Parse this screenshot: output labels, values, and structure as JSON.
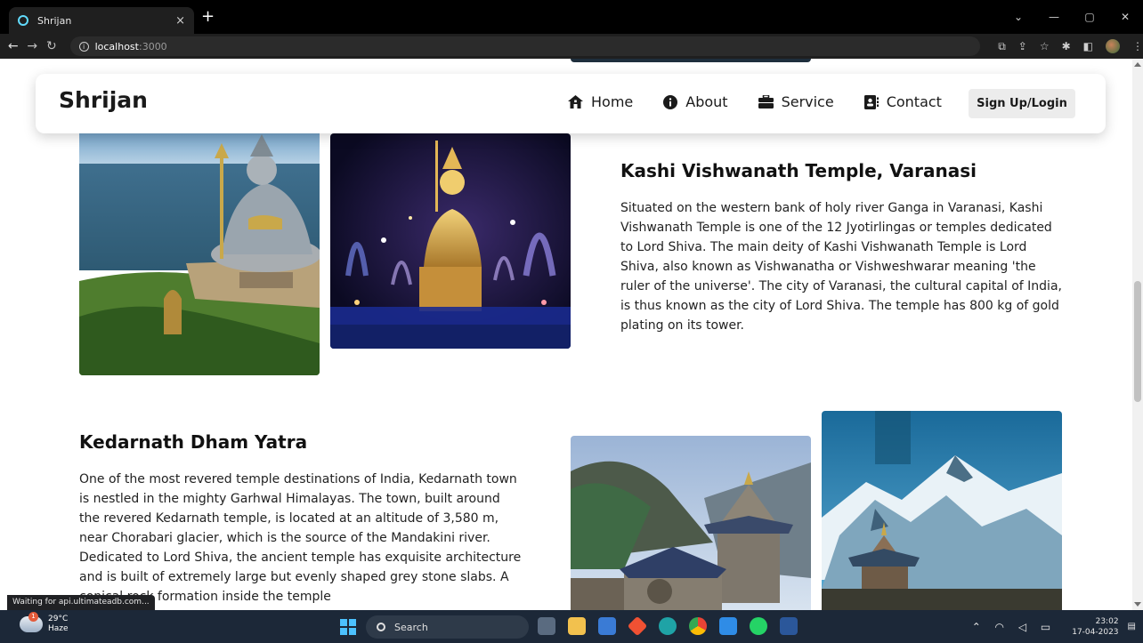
{
  "browser": {
    "tab_title": "Shrijan",
    "tab_close": "×",
    "new_tab": "+",
    "url_host": "localhost",
    "url_port": ":3000",
    "status_text": "Waiting for api.ultimateadb.com..."
  },
  "navbar": {
    "brand": "Shrijan",
    "items": [
      {
        "label": "Home",
        "icon": "home-icon"
      },
      {
        "label": "About",
        "icon": "info-icon"
      },
      {
        "label": "Service",
        "icon": "briefcase-icon"
      },
      {
        "label": "Contact",
        "icon": "address-book-icon"
      }
    ],
    "signup_label": "Sign Up/Login"
  },
  "sections": [
    {
      "title": "Kashi Vishwanath Temple, Varanasi",
      "body": "Situated on the western bank of holy river Ganga in Varanasi, Kashi Vishwanath Temple is one of the 12 Jyotirlingas or temples dedicated to Lord Shiva. The main deity of Kashi Vishwanath Temple is Lord Shiva, also known as Vishwanatha or Vishweshwarar meaning 'the ruler of the universe'. The city of Varanasi, the cultural capital of India, is thus known as the city of Lord Shiva. The temple has 800 kg of gold plating on its tower."
    },
    {
      "title": "Kedarnath Dham Yatra",
      "body": "One of the most revered temple destinations of India, Kedarnath town is nestled in the mighty Garhwal Himalayas. The town, built around the revered Kedarnath temple, is located at an altitude of 3,580 m, near Chorabari glacier, which is the source of the Mandakini river. Dedicated to Lord Shiva, the ancient temple has exquisite architecture and is built of extremely large but evenly shaped grey stone slabs. A conical rock formation inside the temple"
    }
  ],
  "taskbar": {
    "temperature": "29°C",
    "weather": "Haze",
    "weather_badge": "1",
    "search_label": "Search",
    "time": "23:02",
    "date": "17-04-2023"
  }
}
